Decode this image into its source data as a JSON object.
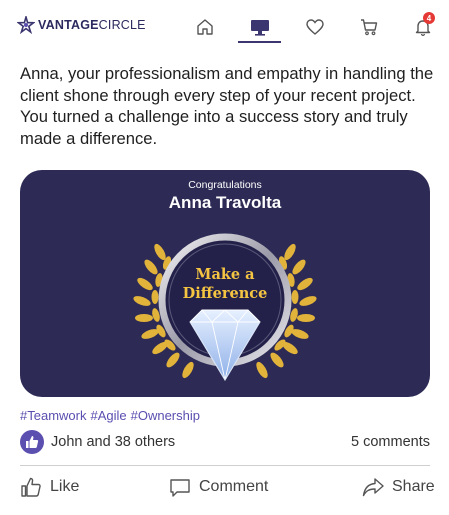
{
  "brand": {
    "name_bold": "VANTAGE",
    "name_light": "CIRCLE"
  },
  "nav": {
    "items": [
      "home-icon",
      "desktop-icon",
      "heart-icon",
      "cart-icon",
      "bell-icon"
    ],
    "active": "desktop-icon",
    "notification_count": "4",
    "accent": "#3b3670",
    "badge_color": "#e53935"
  },
  "post": {
    "text": "Anna, your professionalism and empathy in handling the client shone through every step of your recent project. You turned a challenge into a success story and truly made a difference.",
    "card": {
      "greeting": "Congratulations",
      "recipient": "Anna Travolta",
      "award_line1": "Make a",
      "award_line2": "Difference",
      "background": "#2d2b55",
      "award_color": "#f5c542"
    },
    "hashtags": [
      "#Teamwork",
      "#Agile",
      "#Ownership"
    ],
    "reactions_text": "John and 38 others",
    "comments_text": "5 comments",
    "actions": {
      "like": "Like",
      "comment": "Comment",
      "share": "Share"
    }
  }
}
